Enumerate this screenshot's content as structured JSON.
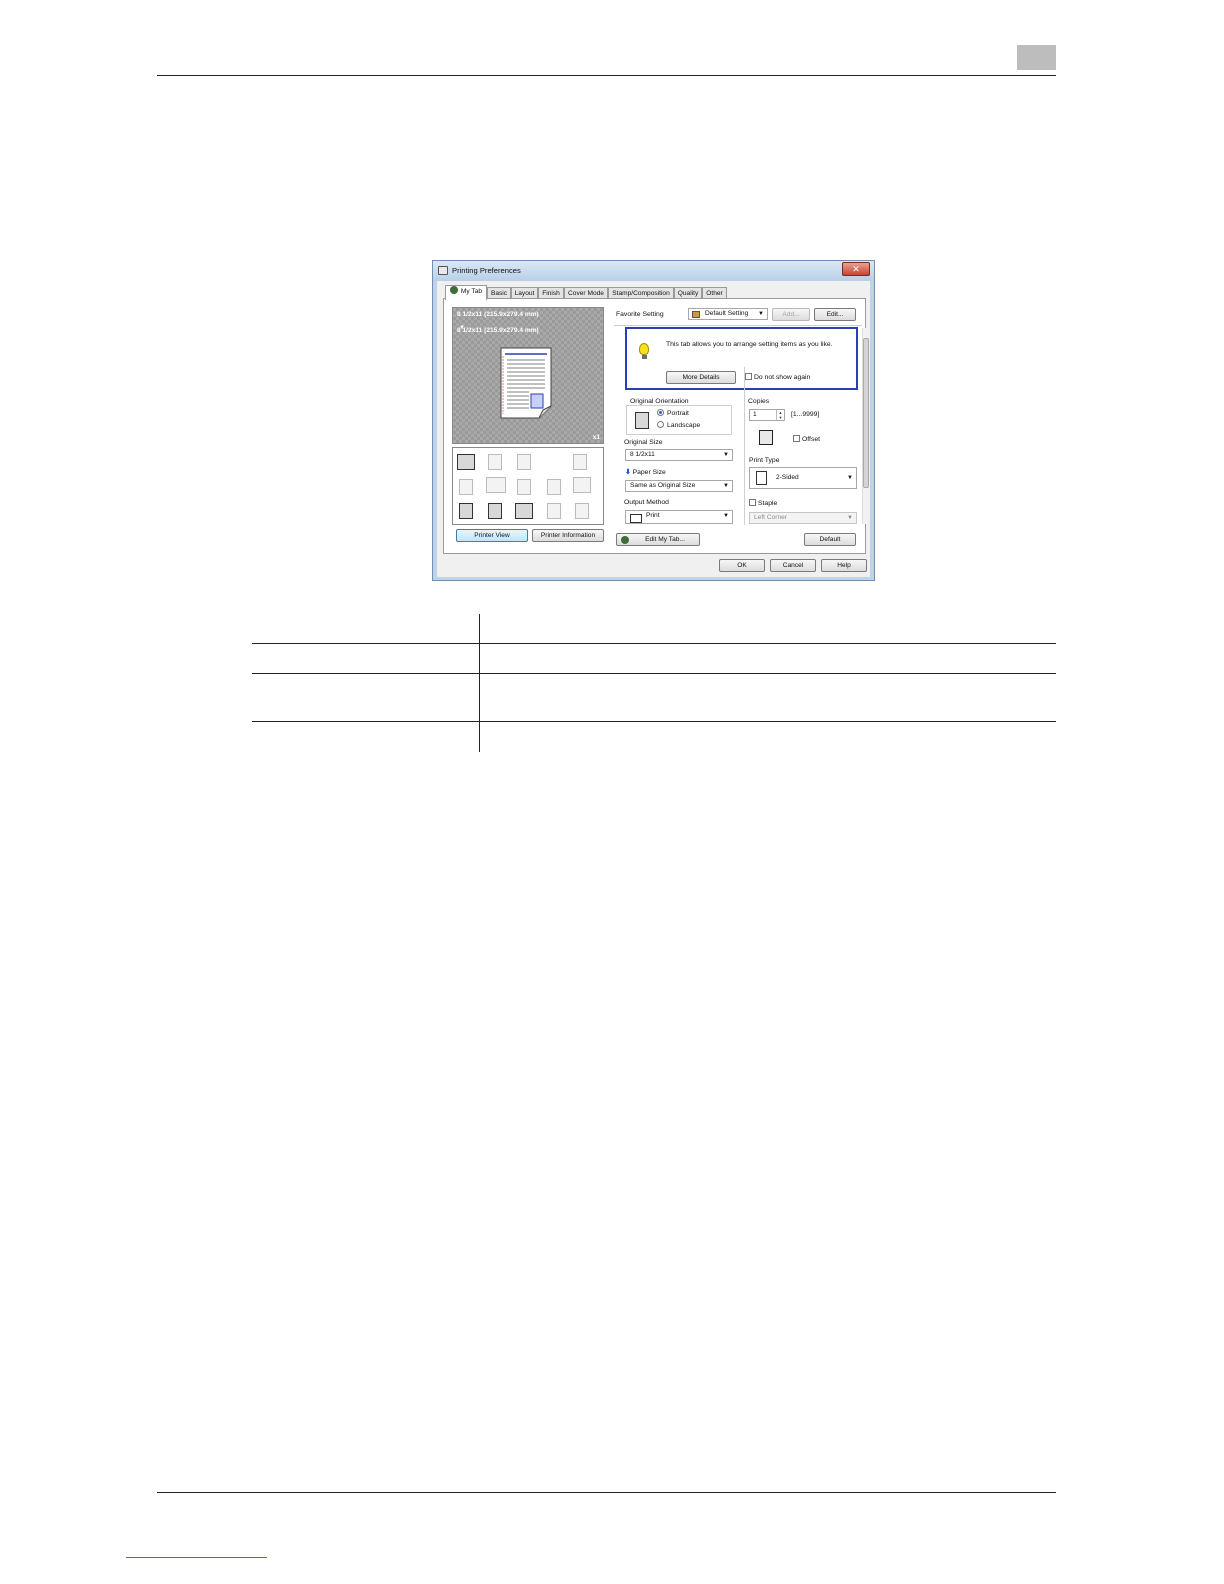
{
  "dialog": {
    "title": "Printing Preferences",
    "close_label": "✕",
    "tabs": [
      {
        "label": "My Tab"
      },
      {
        "label": "Basic"
      },
      {
        "label": "Layout"
      },
      {
        "label": "Finish"
      },
      {
        "label": "Cover Mode"
      },
      {
        "label": "Stamp/Composition"
      },
      {
        "label": "Quality"
      },
      {
        "label": "Other"
      }
    ],
    "preview": {
      "original_line": "8 1/2x11 (215.9x279.4 mm)",
      "arrow": "▼",
      "paper_line": "8 1/2x11 (215.9x279.4 mm)",
      "count": "x1"
    },
    "printer_view_label": "Printer View",
    "printer_information_label": "Printer Information",
    "favorite": {
      "label": "Favorite Setting",
      "value": "Default Setting",
      "add_label": "Add...",
      "edit_label": "Edit..."
    },
    "info_box": {
      "message": "This tab allows you to arrange setting items as you like.",
      "more_details_label": "More Details",
      "do_not_show_label": "Do not show again"
    },
    "original_orientation": {
      "label": "Original Orientation",
      "portrait_label": "Portrait",
      "landscape_label": "Landscape"
    },
    "copies": {
      "label": "Copies",
      "value": "1",
      "range": "[1...9999]",
      "offset_label": "Offset"
    },
    "original_size": {
      "label": "Original Size",
      "value": "8 1/2x11"
    },
    "paper_size": {
      "label": "Paper Size",
      "value": "Same as Original Size"
    },
    "print_type": {
      "label": "Print Type",
      "value": "2-Sided"
    },
    "output_method": {
      "label": "Output Method",
      "value": "Print"
    },
    "staple": {
      "label": "Staple",
      "value": "Left Corner"
    },
    "edit_my_tab_label": "Edit My Tab...",
    "default_label": "Default",
    "ok_label": "OK",
    "cancel_label": "Cancel",
    "help_label": "Help"
  }
}
